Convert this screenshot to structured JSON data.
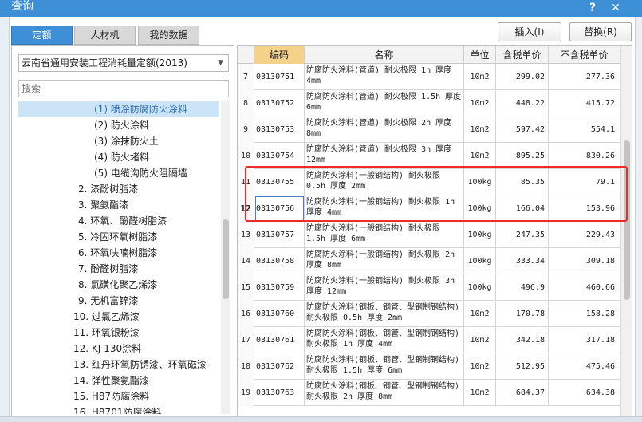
{
  "window": {
    "title": "查询",
    "help_label": "?",
    "close_label": "✕"
  },
  "tabs": [
    {
      "label": "定额",
      "active": true
    },
    {
      "label": "人材机",
      "active": false
    },
    {
      "label": "我的数据",
      "active": false
    }
  ],
  "toolbar": {
    "insert_label": "插入(I)",
    "replace_label": "替换(R)"
  },
  "left": {
    "quota_select": "云南省通用安装工程消耗量定额(2013)",
    "search_placeholder": "搜索",
    "tree_items": [
      "(1) 喷涂防腐防火涂料",
      "(2) 防火涂料",
      "(3) 涂抹防火土",
      "(4) 防火堵料",
      "(5) 电缆沟防火阻隔墙",
      "2. 漆酚树脂漆",
      "3. 聚氨酯漆",
      "4. 环氧、酚醛树脂漆",
      "5. 冷固环氧树脂漆",
      "6. 环氧呋喃树脂漆",
      "7. 酚醛树脂漆",
      "8. 氯磺化聚乙烯漆",
      "9. 无机富锌漆",
      "10. 过氯乙烯漆",
      "11. 环氧银粉漆",
      "12. KJ-130涂料",
      "13. 红丹环氧防锈漆、环氧磁漆",
      "14. 弹性聚氨酯漆",
      "15. H87防腐涂料",
      "16. H8701防腐涂料"
    ]
  },
  "grid": {
    "headers": {
      "code": "编码",
      "name": "名称",
      "unit": "单位",
      "tax_price": "含税单价",
      "notax_price": "不含税单价"
    },
    "rows": [
      {
        "num": "7",
        "code": "03130751",
        "name": "防腐防火涂料(管道) 耐火极限 1h 厚度 4mm",
        "unit": "10m2",
        "tax": "299.02",
        "notax": "277.36"
      },
      {
        "num": "8",
        "code": "03130752",
        "name": "防腐防火涂料(管道) 耐火极限 1.5h 厚度 6mm",
        "unit": "10m2",
        "tax": "448.22",
        "notax": "415.72"
      },
      {
        "num": "9",
        "code": "03130753",
        "name": "防腐防火涂料(管道) 耐火极限 2h 厚度 8mm",
        "unit": "10m2",
        "tax": "597.42",
        "notax": "554.1"
      },
      {
        "num": "10",
        "code": "03130754",
        "name": "防腐防火涂料(管道) 耐火极限 3h 厚度 12mm",
        "unit": "10m2",
        "tax": "895.25",
        "notax": "830.26"
      },
      {
        "num": "11",
        "code": "03130755",
        "name": "防腐防火涂料(一般钢结构) 耐火极限 0.5h 厚度 2mm",
        "unit": "100kg",
        "tax": "85.35",
        "notax": "79.1"
      },
      {
        "num": "12",
        "code": "03130756",
        "name": "防腐防火涂料(一般钢结构) 耐火极限 1h 厚度 4mm",
        "unit": "100kg",
        "tax": "166.04",
        "notax": "153.96"
      },
      {
        "num": "13",
        "code": "03130757",
        "name": "防腐防火涂料(一般钢结构) 耐火极限 1.5h 厚度 6mm",
        "unit": "100kg",
        "tax": "247.35",
        "notax": "229.43"
      },
      {
        "num": "14",
        "code": "03130758",
        "name": "防腐防火涂料(一般钢结构) 耐火极限 2h 厚度 8mm",
        "unit": "100kg",
        "tax": "333.34",
        "notax": "309.18"
      },
      {
        "num": "15",
        "code": "03130759",
        "name": "防腐防火涂料(一般钢结构) 耐火极限 3h 厚度 12mm",
        "unit": "100kg",
        "tax": "496.9",
        "notax": "460.66"
      },
      {
        "num": "16",
        "code": "03130760",
        "name": "防腐防火涂料(钢板、钢管、型钢制钢结构) 耐火极限 0.5h 厚度 2mm",
        "unit": "10m2",
        "tax": "170.78",
        "notax": "158.28"
      },
      {
        "num": "17",
        "code": "03130761",
        "name": "防腐防火涂料(钢板、钢管、型钢制钢结构) 耐火极限 1h 厚度 4mm",
        "unit": "10m2",
        "tax": "342.18",
        "notax": "317.18"
      },
      {
        "num": "18",
        "code": "03130762",
        "name": "防腐防火涂料(钢板、钢管、型钢制钢结构) 耐火极限 1.5h 厚度 6mm",
        "unit": "10m2",
        "tax": "512.95",
        "notax": "475.46"
      },
      {
        "num": "19",
        "code": "03130763",
        "name": "防腐防火涂料(钢板、钢管、型钢制钢结构) 耐火极限 2h 厚度 8mm",
        "unit": "10m2",
        "tax": "684.37",
        "notax": "634.38"
      }
    ]
  }
}
